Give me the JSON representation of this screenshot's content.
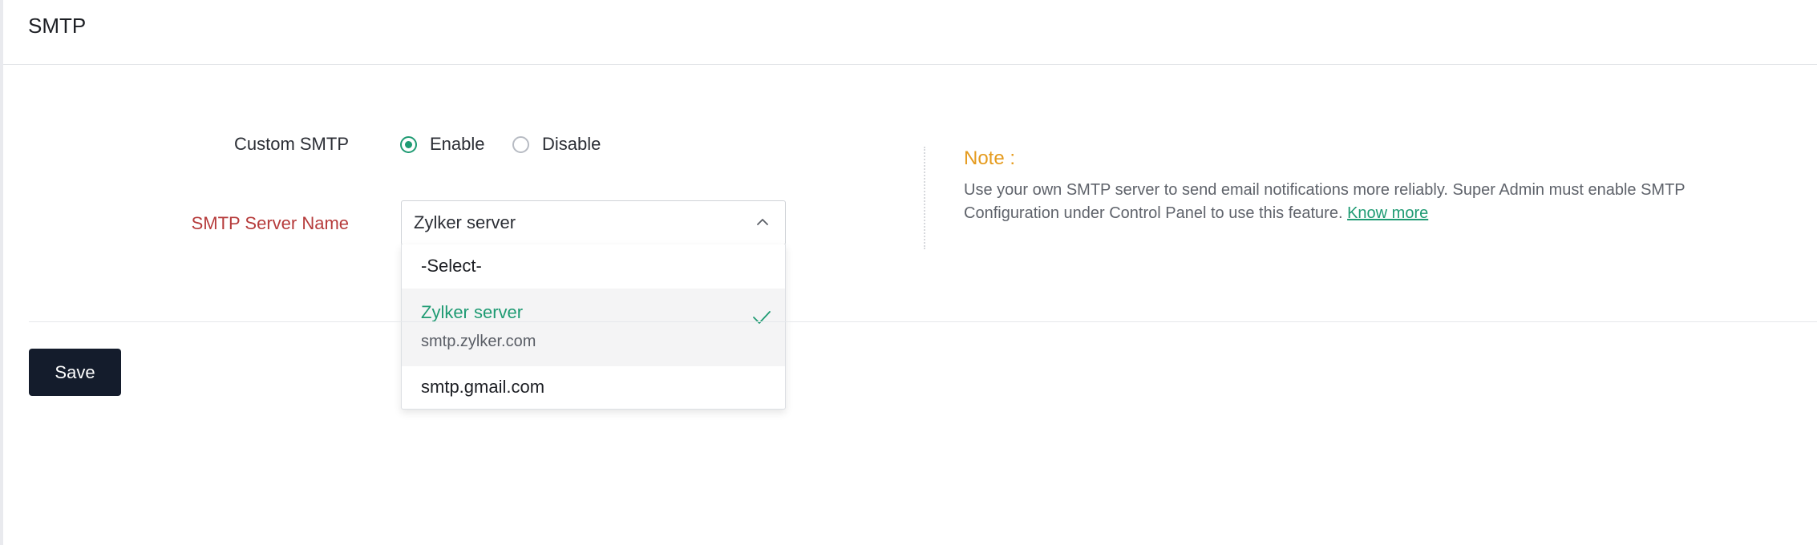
{
  "header": {
    "title": "SMTP"
  },
  "form": {
    "custom_smtp": {
      "label": "Custom SMTP",
      "options": [
        {
          "label": "Enable",
          "checked": true
        },
        {
          "label": "Disable",
          "checked": false
        }
      ]
    },
    "smtp_server": {
      "label": "SMTP Server Name",
      "selected": "Zylker server",
      "options": [
        {
          "label": "-Select-"
        },
        {
          "label": "Zylker server",
          "sub": "smtp.zylker.com",
          "selected": true
        },
        {
          "label": "smtp.gmail.com"
        }
      ]
    }
  },
  "note": {
    "title": "Note :",
    "text": "Use your own SMTP server to send email notifications more reliably. Super Admin must enable SMTP Configuration under Control Panel to use this feature.",
    "link": "Know more"
  },
  "actions": {
    "save_label": "Save"
  },
  "colors": {
    "accent": "#1f9b73",
    "required_label": "#b63b3b",
    "note_title": "#e59b1e",
    "save_button": "#141c2c"
  }
}
